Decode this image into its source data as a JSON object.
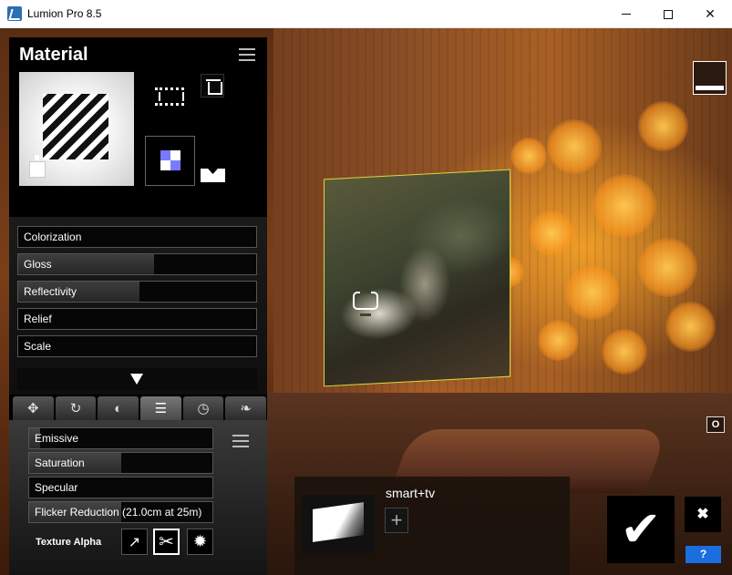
{
  "window": {
    "title": "Lumion Pro 8.5",
    "minimize_label": "",
    "maximize_label": "",
    "close_label": "✕"
  },
  "panel": {
    "title": "Material",
    "sliders": [
      {
        "label": "Colorization",
        "level": 0
      },
      {
        "label": "Gloss",
        "level": 0.57
      },
      {
        "label": "Reflectivity",
        "level": 0.51
      },
      {
        "label": "Relief",
        "level": 0
      },
      {
        "label": "Scale",
        "level": 0
      }
    ],
    "tabs": [
      {
        "icon": "move-icon",
        "glyph": "✥"
      },
      {
        "icon": "rotate-icon",
        "glyph": "↻"
      },
      {
        "icon": "contrast-icon",
        "glyph": "◐"
      },
      {
        "icon": "sliders-icon",
        "glyph": "☰"
      },
      {
        "icon": "clock-icon",
        "glyph": "◷"
      },
      {
        "icon": "leaf-icon",
        "glyph": "❧"
      }
    ],
    "active_tab": 3,
    "lower_sliders": [
      {
        "label": "Emissive",
        "level": 0.06
      },
      {
        "label": "Saturation",
        "level": 0.5
      },
      {
        "label": "Specular",
        "level": 0
      },
      {
        "label": "Flicker Reduction (21.0cm at 25m)",
        "level": 0.5
      }
    ],
    "texture_alpha_label": "Texture Alpha"
  },
  "object_strip": {
    "name": "smart+tv",
    "add_glyph": "+"
  },
  "buttons": {
    "ok_glyph": "✔",
    "cancel_glyph": "✖",
    "help_label": "?",
    "o_key_label": "O"
  },
  "icons": {
    "curve": "↗",
    "scissors": "✂",
    "sun": "✹"
  }
}
